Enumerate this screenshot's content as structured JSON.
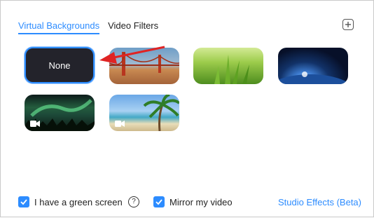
{
  "tabs": [
    {
      "label": "Virtual Backgrounds",
      "active": true
    },
    {
      "label": "Video Filters",
      "active": false
    }
  ],
  "add_button_icon": "plus-icon",
  "backgrounds": [
    {
      "label": "None",
      "selected": true
    },
    {
      "name": "golden-gate-bridge"
    },
    {
      "name": "grass"
    },
    {
      "name": "earth-from-space"
    },
    {
      "name": "aurora",
      "is_video": true
    },
    {
      "name": "beach-palm",
      "is_video": true
    }
  ],
  "annotation_arrow_color": "#e02424",
  "footer": {
    "green_screen_label": "I have a green screen",
    "green_screen_checked": true,
    "mirror_label": "Mirror my video",
    "mirror_checked": true,
    "studio_effects_label": "Studio Effects (Beta)"
  },
  "accent_color": "#2d8cff"
}
